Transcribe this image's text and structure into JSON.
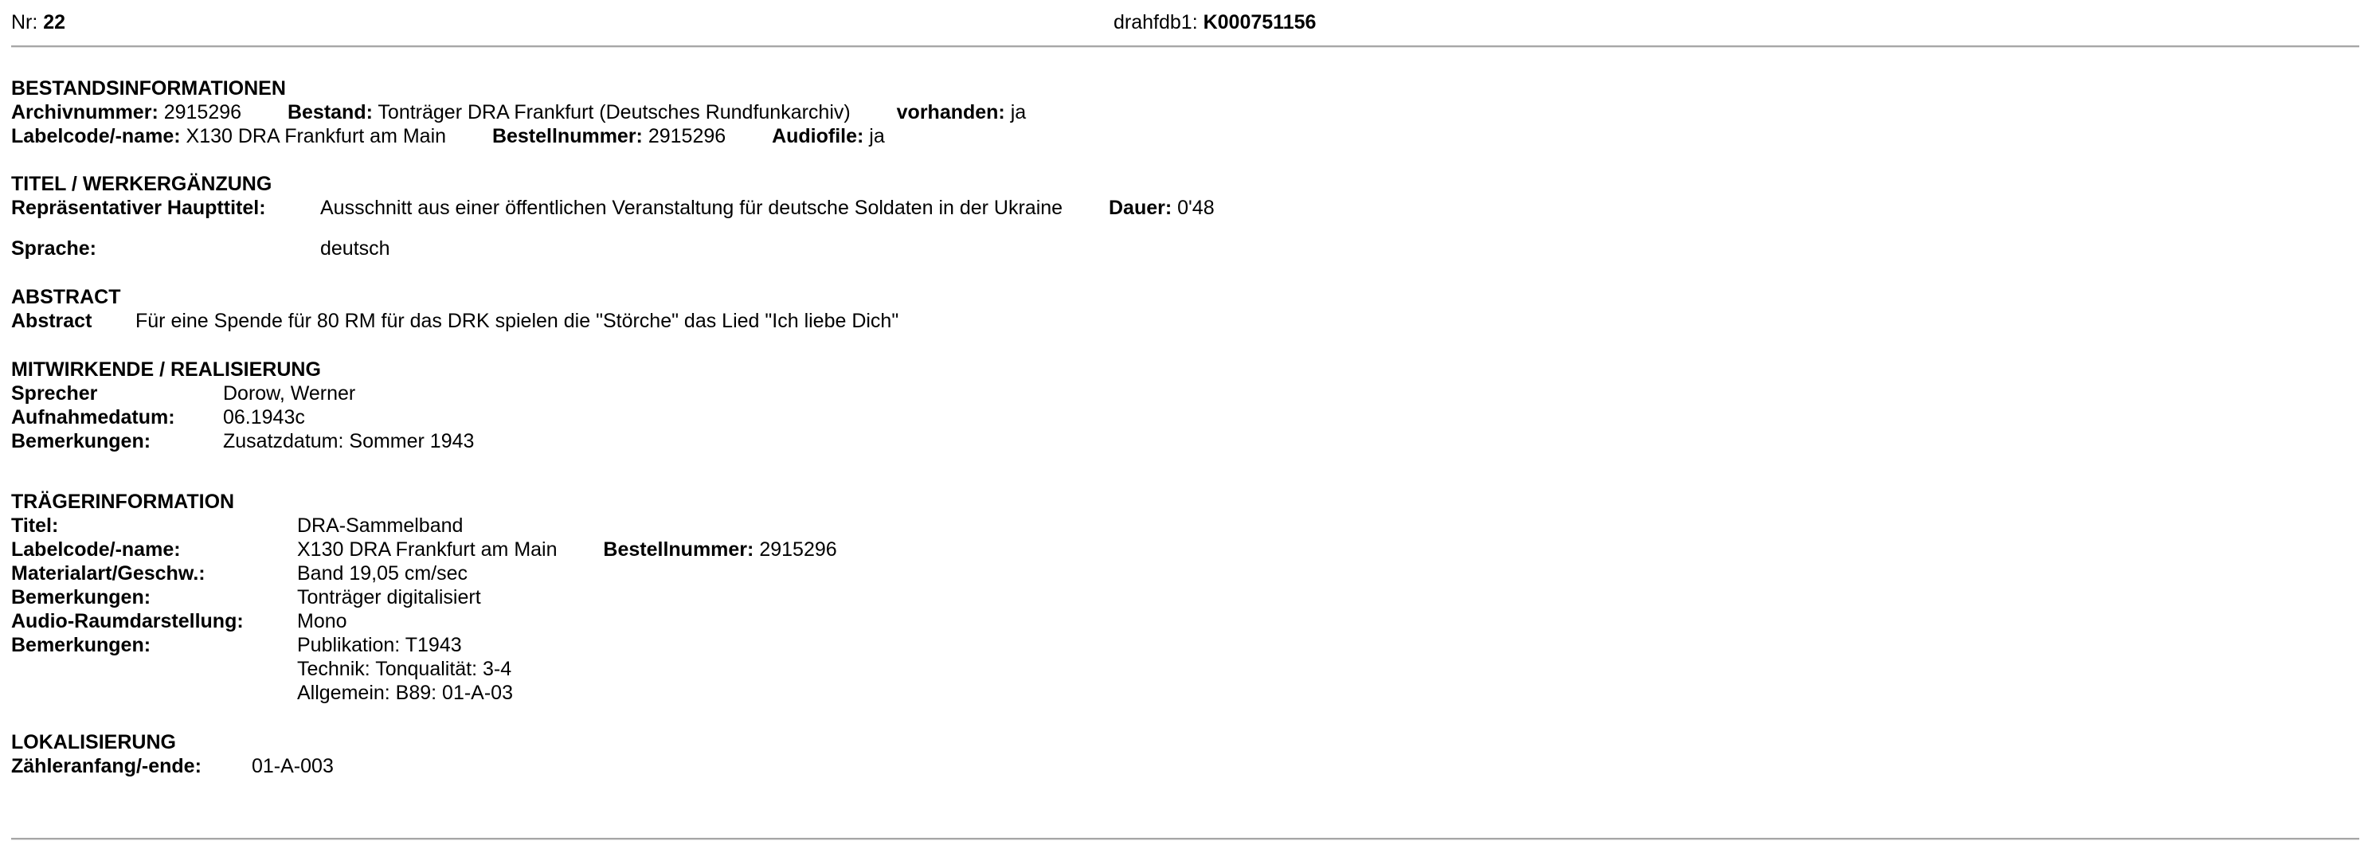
{
  "header": {
    "nr_label": "Nr:",
    "nr_value": "22",
    "db_label": "drahfdb1:",
    "db_value": "K000751156"
  },
  "bestand": {
    "heading": "BESTANDSINFORMATIONEN",
    "archivnummer_label": "Archivnummer:",
    "archivnummer_value": "2915296",
    "bestand_label": "Bestand:",
    "bestand_value": "Tonträger DRA Frankfurt (Deutsches Rundfunkarchiv)",
    "vorhanden_label": "vorhanden:",
    "vorhanden_value": "ja",
    "labelcode_label": "Labelcode/-name:",
    "labelcode_value": "X130 DRA Frankfurt am Main",
    "bestellnummer_label": "Bestellnummer:",
    "bestellnummer_value": "2915296",
    "audiofile_label": "Audiofile:",
    "audiofile_value": "ja"
  },
  "titel": {
    "heading": "TITEL / WERKERGÄNZUNG",
    "haupttitel_label": "Repräsentativer Haupttitel:",
    "haupttitel_value": "Ausschnitt aus einer öffentlichen Veranstaltung für deutsche Soldaten in der Ukraine",
    "dauer_label": "Dauer:",
    "dauer_value": "0'48",
    "sprache_label": "Sprache:",
    "sprache_value": "deutsch"
  },
  "abstract": {
    "heading": "ABSTRACT",
    "label": "Abstract",
    "value": "Für eine Spende für 80 RM für das DRK spielen die \"Störche\" das Lied \"Ich liebe Dich\""
  },
  "mitwirkende": {
    "heading": "MITWIRKENDE / REALISIERUNG",
    "sprecher_label": "Sprecher",
    "sprecher_value": "Dorow, Werner",
    "aufnahmedatum_label": "Aufnahmedatum:",
    "aufnahmedatum_value": "06.1943c",
    "bemerkungen_label": "Bemerkungen:",
    "bemerkungen_value": "Zusatzdatum: Sommer 1943"
  },
  "traeger": {
    "heading": "TRÄGERINFORMATION",
    "titel_label": "Titel:",
    "titel_value": "DRA-Sammelband",
    "labelcode_label": "Labelcode/-name:",
    "labelcode_value": "X130 DRA Frankfurt am Main",
    "bestellnummer_label": "Bestellnummer:",
    "bestellnummer_value": "2915296",
    "material_label": "Materialart/Geschw.:",
    "material_value": "Band 19,05 cm/sec",
    "bemerkungen1_label": "Bemerkungen:",
    "bemerkungen1_value": "Tonträger digitalisiert",
    "audioraum_label": "Audio-Raumdarstellung:",
    "audioraum_value": "Mono",
    "bemerkungen2_label": "Bemerkungen:",
    "bemerkungen2_lines": [
      "Publikation: T1943",
      "Technik: Tonqualität: 3-4",
      "Allgemein: B89: 01-A-03"
    ]
  },
  "lokalisierung": {
    "heading": "LOKALISIERUNG",
    "zaehler_label": "Zähleranfang/-ende:",
    "zaehler_value": "01-A-003"
  }
}
